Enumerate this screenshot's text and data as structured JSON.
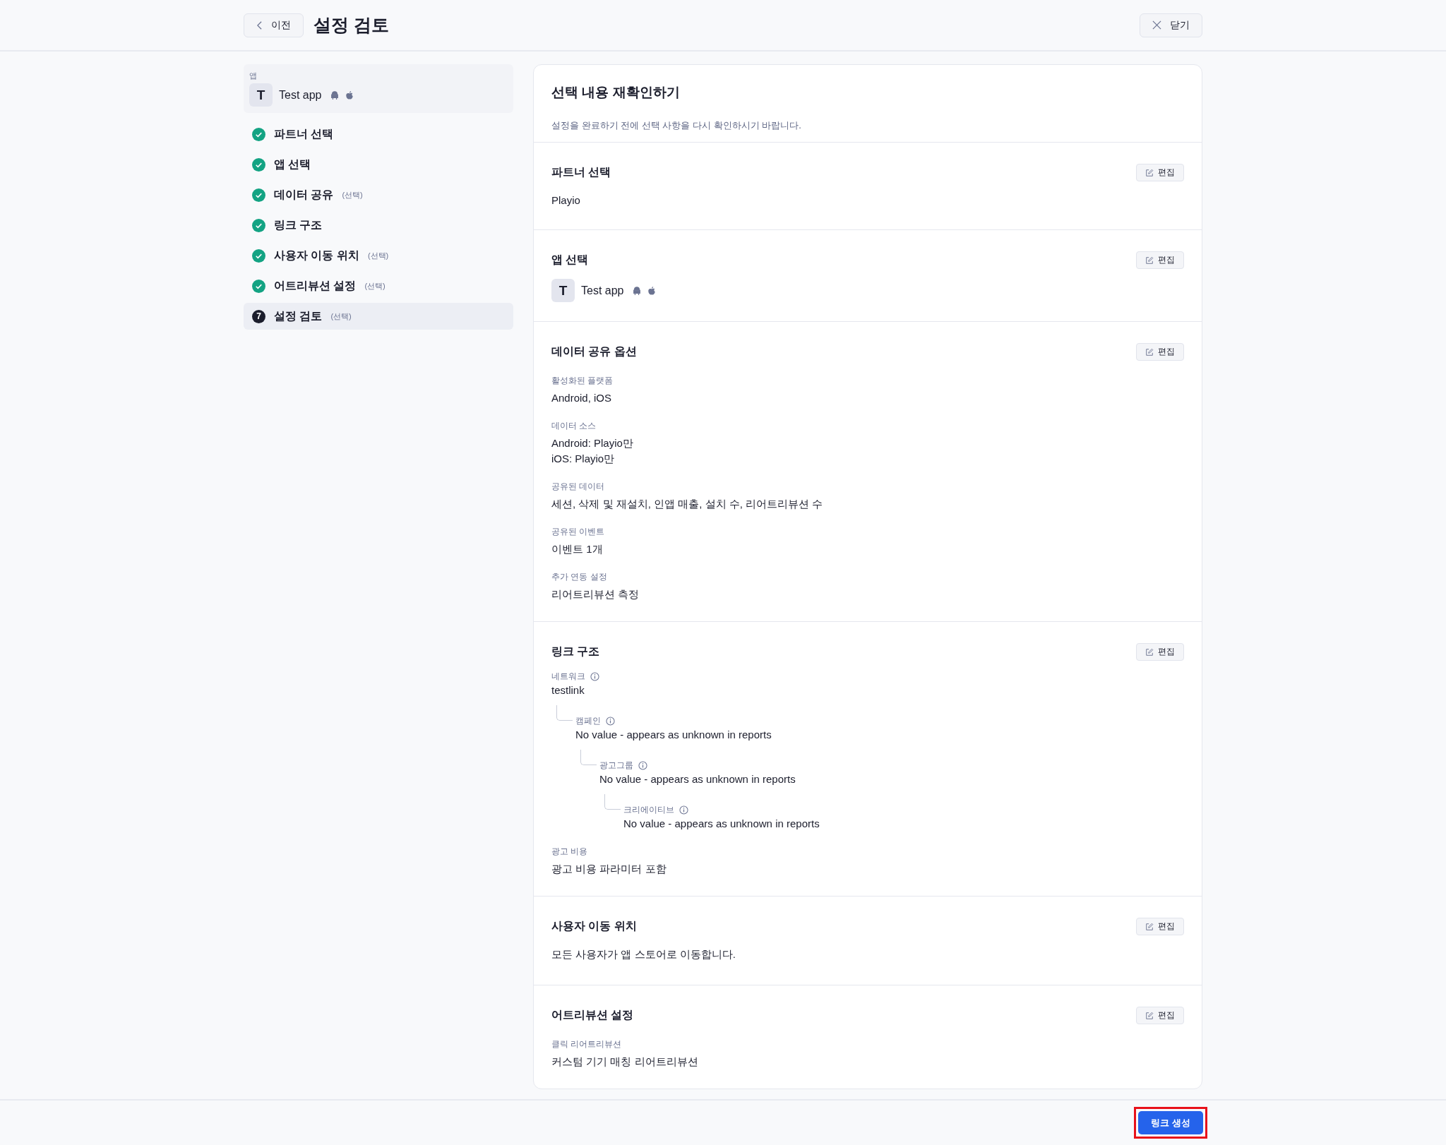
{
  "header": {
    "back_label": "이전",
    "title": "설정 검토",
    "close_label": "닫기"
  },
  "sidebar": {
    "app_label": "앱",
    "app": {
      "initial": "T",
      "name": "Test app"
    },
    "steps": [
      {
        "label": "파트너 선택",
        "completed": true,
        "selected": false
      },
      {
        "label": "앱 선택",
        "completed": true,
        "selected": false
      },
      {
        "label": "데이터 공유",
        "tag": "(선택)",
        "completed": true,
        "selected": false
      },
      {
        "label": "링크 구조",
        "completed": true,
        "selected": false
      },
      {
        "label": "사용자 이동 위치",
        "tag": "(선택)",
        "completed": true,
        "selected": false
      },
      {
        "label": "어트리뷰션 설정",
        "tag": "(선택)",
        "completed": true,
        "selected": false
      },
      {
        "label": "설정 검토",
        "tag": "(선택)",
        "completed": false,
        "number": "7",
        "selected": true
      }
    ]
  },
  "review": {
    "title": "선택 내용 재확인하기",
    "subtitle": "설정을 완료하기 전에 선택 사항을 다시 확인하시기 바랍니다.",
    "sections": [
      {
        "kind": "text",
        "title": "파트너 선택",
        "edit_label": "편집",
        "value": "Playio"
      },
      {
        "kind": "app",
        "title": "앱 선택",
        "edit_label": "편집",
        "app": {
          "initial": "T",
          "name": "Test app"
        }
      },
      {
        "kind": "fields",
        "title": "데이터 공유 옵션",
        "edit_label": "편집",
        "fields": [
          {
            "label": "활성화된 플랫폼",
            "lines": [
              "Android, iOS"
            ]
          },
          {
            "label": "데이터 소스",
            "lines": [
              "Android: Playio만",
              "iOS: Playio만"
            ]
          },
          {
            "label": "공유된 데이터",
            "lines": [
              "세션, 삭제 및 재설치, 인앱 매출, 설치 수, 리어트리뷰션 수"
            ]
          },
          {
            "label": "공유된 이벤트",
            "lines": [
              "이벤트 1개"
            ]
          },
          {
            "label": "추가 연동 설정",
            "lines": [
              "리어트리뷰션 측정"
            ]
          }
        ]
      },
      {
        "kind": "tree",
        "title": "링크 구조",
        "edit_label": "편집",
        "tree": {
          "label": "네트워크",
          "value": "testlink",
          "children": [
            {
              "label": "캠페인",
              "value": "No value - appears as unknown in reports",
              "children": [
                {
                  "label": "광고그룹",
                  "value": "No value - appears as unknown in reports",
                  "children": [
                    {
                      "label": "크리에이티브",
                      "value": "No value - appears as unknown in reports"
                    }
                  ]
                }
              ]
            }
          ]
        },
        "fields": [
          {
            "label": "광고 비용",
            "lines": [
              "광고 비용 파라미터 포함"
            ]
          }
        ]
      },
      {
        "kind": "text",
        "title": "사용자 이동 위치",
        "edit_label": "편집",
        "value": "모든 사용자가 앱 스토어로 이동합니다."
      },
      {
        "kind": "fields",
        "title": "어트리뷰션 설정",
        "edit_label": "편집",
        "fields": [
          {
            "label": "클릭 리어트리뷰션",
            "lines": [
              "커스텀 기기 매칭 리어트리뷰션"
            ]
          }
        ]
      }
    ]
  },
  "footer": {
    "primary_label": "링크 생성",
    "highlighted": true
  }
}
